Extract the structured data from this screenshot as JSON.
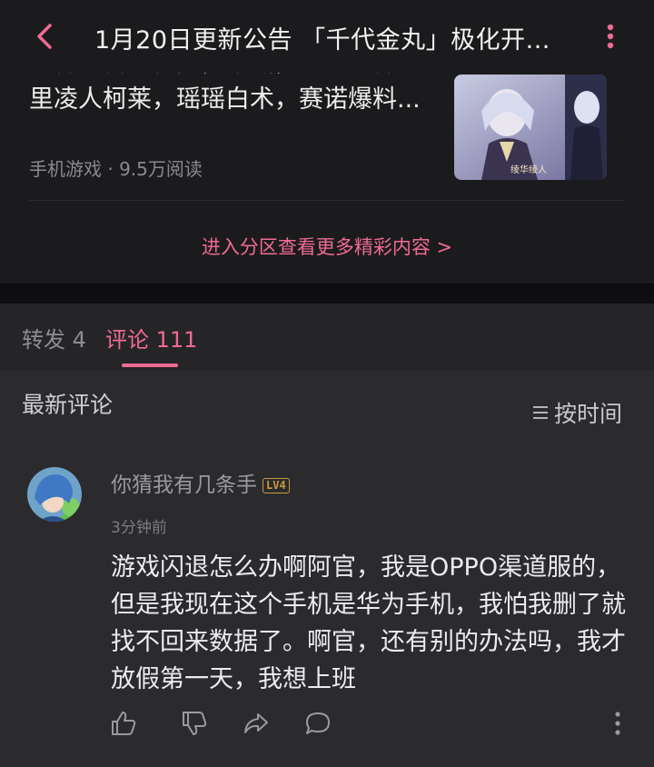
{
  "header": {
    "title": "1月20日更新公告 「千代金丸」极化开..."
  },
  "card": {
    "text_lines": [
      "原神爆料：夜阑，平藏，久岐忍神",
      "里凌人柯莱，瑶瑶白术，赛诺爆料..."
    ],
    "meta": "手机游戏 · 9.5万阅读",
    "thumb_caption": "绫华绫人",
    "enter_link": "进入分区查看更多精彩内容 >"
  },
  "tabs": {
    "repost": "转发 4",
    "comment": "评论 111"
  },
  "comments_section": {
    "heading": "最新评论",
    "sort_label": "按时间"
  },
  "comment": {
    "username": "你猜我有几条手",
    "level": "LV4",
    "time": "3分钟前",
    "body": "游戏闪退怎么办啊阿官，我是OPPO渠道服的，但是我现在这个手机是华为手机，我怕我删了就找不回来数据了。啊官，还有别的办法吗，我才放假第一天，我想上班"
  },
  "colors": {
    "accent": "#f06a92",
    "background": "#1b1b1d",
    "comment_bg": "#2b2b2e"
  },
  "icons": {
    "back": "chevron-left-icon",
    "menu": "vertical-dots-icon",
    "sort": "list-lines-icon",
    "like": "thumbs-up-icon",
    "dislike": "thumbs-down-icon",
    "share": "share-arrow-icon",
    "reply": "chat-bubble-icon"
  }
}
